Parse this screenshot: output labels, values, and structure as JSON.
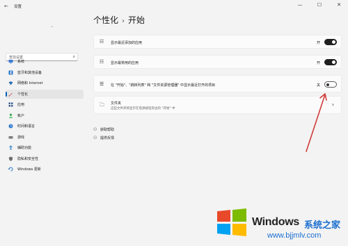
{
  "window": {
    "title": "设置",
    "back_glyph": "←",
    "controls": {
      "minimize": "—",
      "maximize": "☐",
      "close": "✕"
    }
  },
  "sidebar": {
    "user_marker": "ˆ",
    "search_placeholder": "查找设置",
    "items": [
      {
        "label": "系统",
        "icon": "monitor-icon",
        "color": "#3a7bd5"
      },
      {
        "label": "蓝牙和其他设备",
        "icon": "bluetooth-icon",
        "color": "#1f6fc5"
      },
      {
        "label": "网络和 Internet",
        "icon": "wifi-icon",
        "color": "#2f6fb3"
      },
      {
        "label": "个性化",
        "icon": "brush-icon",
        "color": "#c0504d"
      },
      {
        "label": "应用",
        "icon": "apps-icon",
        "color": "#3b5d8f"
      },
      {
        "label": "帐户",
        "icon": "account-icon",
        "color": "#2ba84a"
      },
      {
        "label": "时间和语言",
        "icon": "globe-clock-icon",
        "color": "#2e7bcf"
      },
      {
        "label": "游戏",
        "icon": "gamepad-icon",
        "color": "#6d6d6d"
      },
      {
        "label": "辅助功能",
        "icon": "accessibility-icon",
        "color": "#1f73c9"
      },
      {
        "label": "隐私和安全性",
        "icon": "shield-icon",
        "color": "#6d6d6d"
      },
      {
        "label": "Windows 更新",
        "icon": "update-icon",
        "color": "#1f73c9"
      }
    ],
    "active_index": 3
  },
  "main": {
    "breadcrumb_parent": "个性化",
    "breadcrumb_sep": "›",
    "breadcrumb_current": "开始",
    "cards": [
      {
        "label": "显示最近添加的应用",
        "state": "开",
        "toggle_on": true
      },
      {
        "label": "显示最常用的应用",
        "state": "开",
        "toggle_on": true
      },
      {
        "label": "在 \"开始\"、\"跳转列表\" 和 \"文件资源管理器\" 中显示最近打开的项目",
        "state": "关",
        "toggle_on": false
      },
      {
        "label": "文件夹",
        "sub": "这些文件夹将显示在电源按钮旁边的 \"开始\" 中",
        "chevron": "›"
      }
    ],
    "links": [
      {
        "label": "获取帮助",
        "icon": "help-icon"
      },
      {
        "label": "提供反馈",
        "icon": "feedback-icon"
      }
    ]
  },
  "watermark": {
    "brand": "Windows",
    "brand_cn": "系统之家",
    "url": "www.bjjmlv.com",
    "colors": {
      "red": "#e8492a",
      "green": "#7cbb00",
      "blue": "#00a1f1",
      "yellow": "#ffbb00"
    }
  },
  "accent": {
    "highlight": "#005fb8",
    "arrow": "#d13b3b"
  }
}
